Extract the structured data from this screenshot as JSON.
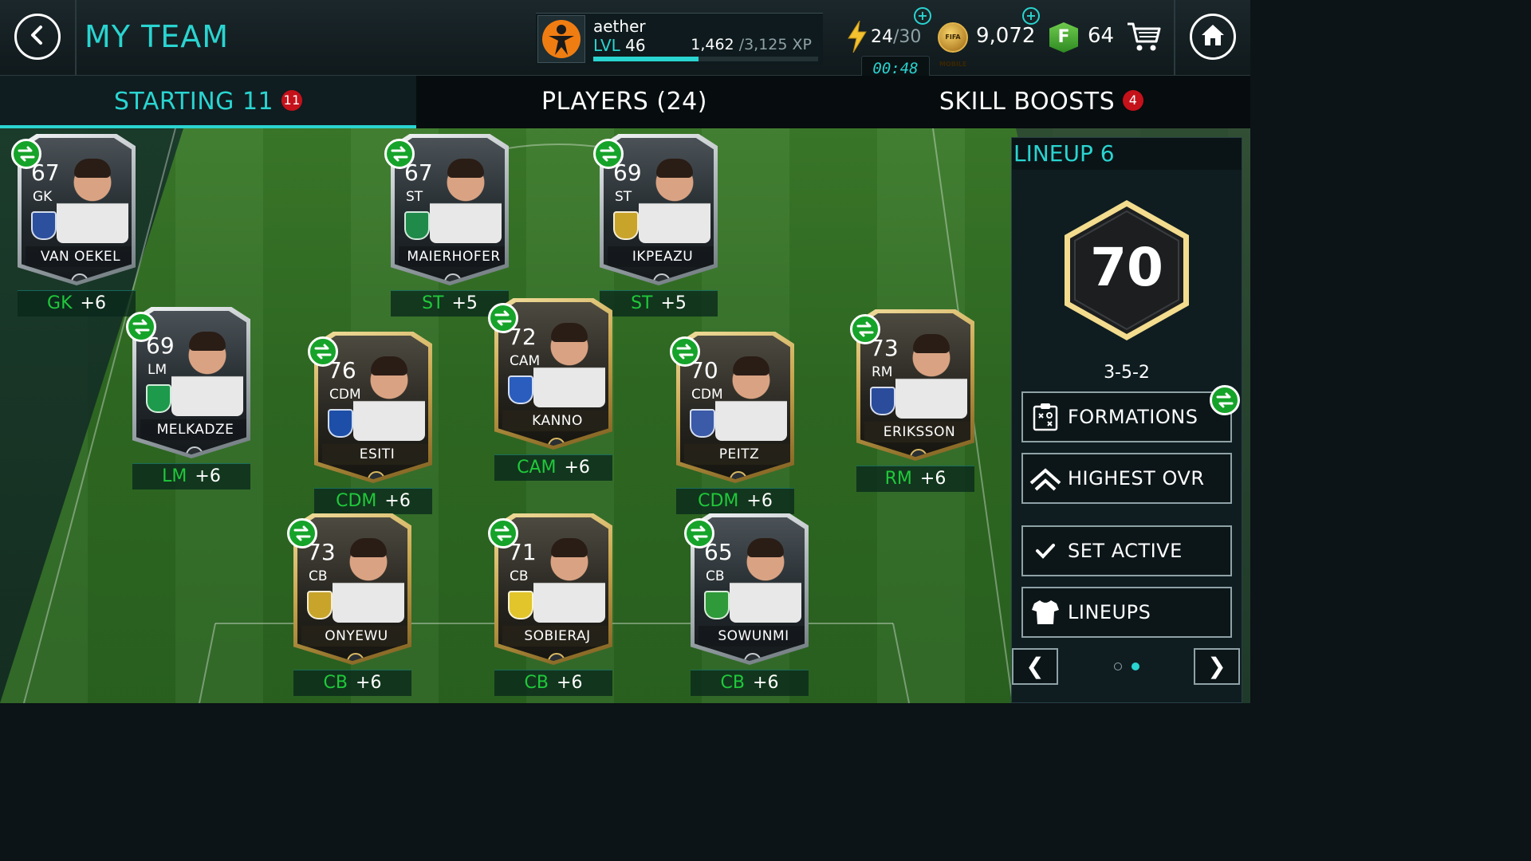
{
  "header": {
    "title": "MY TEAM",
    "back_icon": "chevron-left-icon",
    "home_icon": "home-icon"
  },
  "profile": {
    "username": "aether",
    "level_prefix": "LVL",
    "level": "46",
    "xp_current": "1,462",
    "xp_max": "/3,125 XP",
    "xp_progress": 0.468
  },
  "energy": {
    "current": "24",
    "max": "/30",
    "timer": "00:48"
  },
  "currency": {
    "coins": "9,072",
    "coin_label": "FIFA MOBILE",
    "fifa_points": "64",
    "fifa_points_icon_letter": "F"
  },
  "tabs": [
    {
      "label": "STARTING 11",
      "badge": "11",
      "active": true
    },
    {
      "label": "PLAYERS (24)",
      "badge": "",
      "active": false
    },
    {
      "label": "SKILL BOOSTS",
      "badge": "4",
      "active": false
    }
  ],
  "players": [
    {
      "name": "VAN OEKEL",
      "rating": "67",
      "position": "GK",
      "boost": "+6",
      "tier": "silver",
      "crest": "#2c4f9e"
    },
    {
      "name": "MAIERHOFER",
      "rating": "67",
      "position": "ST",
      "boost": "+5",
      "tier": "silver",
      "crest": "#1f8a4a"
    },
    {
      "name": "IKPEAZU",
      "rating": "69",
      "position": "ST",
      "boost": "+5",
      "tier": "silver",
      "crest": "#c9a42a"
    },
    {
      "name": "MELKADZE",
      "rating": "69",
      "position": "LM",
      "boost": "+6",
      "tier": "silver",
      "crest": "#1e9a4c"
    },
    {
      "name": "ESITI",
      "rating": "76",
      "position": "CDM",
      "boost": "+6",
      "tier": "gold",
      "crest": "#1d4fa8"
    },
    {
      "name": "KANNO",
      "rating": "72",
      "position": "CAM",
      "boost": "+6",
      "tier": "gold",
      "crest": "#2a5dbd"
    },
    {
      "name": "PEITZ",
      "rating": "70",
      "position": "CDM",
      "boost": "+6",
      "tier": "gold",
      "crest": "#3b5aa8"
    },
    {
      "name": "ERIKSSON",
      "rating": "73",
      "position": "RM",
      "boost": "+6",
      "tier": "gold",
      "crest": "#2a4c9a"
    },
    {
      "name": "ONYEWU",
      "rating": "73",
      "position": "CB",
      "boost": "+6",
      "tier": "gold",
      "crest": "#c9a42a"
    },
    {
      "name": "SOBIERAJ",
      "rating": "71",
      "position": "CB",
      "boost": "+6",
      "tier": "gold",
      "crest": "#e2c52a"
    },
    {
      "name": "SOWUNMI",
      "rating": "65",
      "position": "CB",
      "boost": "+6",
      "tier": "silver",
      "crest": "#2e9a3a"
    }
  ],
  "lineup": {
    "title": "LINEUP 6",
    "ovr": "70",
    "formation": "3-5-2",
    "buttons": [
      {
        "label": "FORMATIONS",
        "icon": "formation-board-icon"
      },
      {
        "label": "HIGHEST OVR",
        "icon": "chevron-up-icon"
      },
      {
        "label": "SET ACTIVE",
        "icon": "check-icon"
      },
      {
        "label": "LINEUPS",
        "icon": "jersey-icon"
      }
    ],
    "prev_label": "❮",
    "next_label": "❯",
    "page_count": 2,
    "page_active": 2
  },
  "colors": {
    "accent": "#2ad4d0",
    "position_green": "#20c83a",
    "badge_red": "#c4111a",
    "swap_green": "#16a32a"
  }
}
